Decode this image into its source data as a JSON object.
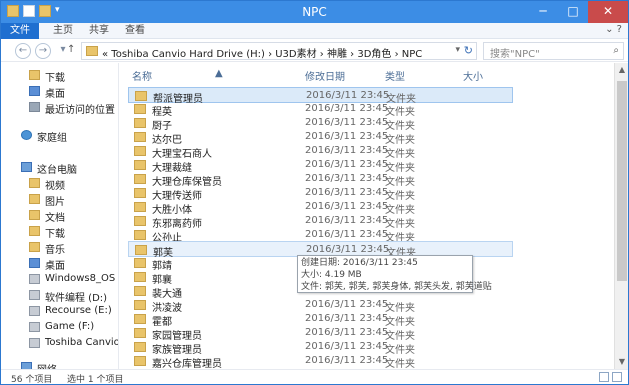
{
  "window": {
    "title": "NPC"
  },
  "ribbon": {
    "tabs": [
      "文件",
      "主页",
      "共享",
      "查看"
    ]
  },
  "address": {
    "path": "« Toshiba Canvio Hard Drive (H:) › U3D素材 › 神雕 › 3D角色 › NPC",
    "search_placeholder": "搜索\"NPC\""
  },
  "sidebar": {
    "items": [
      {
        "label": "下载",
        "icon": "download-folder-icon"
      },
      {
        "label": "桌面",
        "icon": "desktop-icon"
      },
      {
        "label": "最近访问的位置",
        "icon": "recent-places-icon"
      },
      {
        "label": "家庭组",
        "icon": "homegroup-icon"
      },
      {
        "label": "这台电脑",
        "icon": "this-pc-icon"
      },
      {
        "label": "视频",
        "icon": "videos-folder-icon"
      },
      {
        "label": "图片",
        "icon": "pictures-folder-icon"
      },
      {
        "label": "文档",
        "icon": "documents-folder-icon"
      },
      {
        "label": "下载",
        "icon": "download-folder-icon"
      },
      {
        "label": "音乐",
        "icon": "music-folder-icon"
      },
      {
        "label": "桌面",
        "icon": "desktop-icon"
      },
      {
        "label": "Windows8_OS (C",
        "icon": "drive-icon"
      },
      {
        "label": "软件编程 (D:)",
        "icon": "drive-icon"
      },
      {
        "label": "Recourse (E:)",
        "icon": "drive-icon"
      },
      {
        "label": "Game (F:)",
        "icon": "drive-icon"
      },
      {
        "label": "Toshiba Canvio I",
        "icon": "external-drive-icon"
      },
      {
        "label": "网络",
        "icon": "network-icon"
      }
    ]
  },
  "columns": [
    "名称",
    "修改日期",
    "类型",
    "大小"
  ],
  "files": [
    {
      "name": "帮派管理员",
      "date": "2016/3/11 23:45",
      "type": "文件夹"
    },
    {
      "name": "程英",
      "date": "2016/3/11 23:45",
      "type": "文件夹"
    },
    {
      "name": "厨子",
      "date": "2016/3/11 23:45",
      "type": "文件夹"
    },
    {
      "name": "达尔巴",
      "date": "2016/3/11 23:45",
      "type": "文件夹"
    },
    {
      "name": "大理宝石商人",
      "date": "2016/3/11 23:45",
      "type": "文件夹"
    },
    {
      "name": "大理裁缝",
      "date": "2016/3/11 23:45",
      "type": "文件夹"
    },
    {
      "name": "大理仓库保管员",
      "date": "2016/3/11 23:45",
      "type": "文件夹"
    },
    {
      "name": "大理传送师",
      "date": "2016/3/11 23:45",
      "type": "文件夹"
    },
    {
      "name": "大胜小体",
      "date": "2016/3/11 23:45",
      "type": "文件夹"
    },
    {
      "name": "东邪离药师",
      "date": "2016/3/11 23:45",
      "type": "文件夹"
    },
    {
      "name": "公孙止",
      "date": "2016/3/11 23:45",
      "type": "文件夹"
    },
    {
      "name": "郭芙",
      "date": "2016/3/11 23:45",
      "type": "文件夹"
    },
    {
      "name": "郭靖",
      "date": "",
      "type": ""
    },
    {
      "name": "郭襄",
      "date": "",
      "type": ""
    },
    {
      "name": "裴大通",
      "date": "",
      "type": ""
    },
    {
      "name": "洪凌波",
      "date": "2016/3/11 23:45",
      "type": "文件夹"
    },
    {
      "name": "霍都",
      "date": "2016/3/11 23:45",
      "type": "文件夹"
    },
    {
      "name": "家园管理员",
      "date": "2016/3/11 23:45",
      "type": "文件夹"
    },
    {
      "name": "家族管理员",
      "date": "2016/3/11 23:45",
      "type": "文件夹"
    },
    {
      "name": "嘉兴仓库管理员",
      "date": "2016/3/11 23:45",
      "type": "文件夹"
    }
  ],
  "tooltip": {
    "created": "创建日期: 2016/3/11 23:45",
    "size": "大小: 4.19 MB",
    "files": "文件: 郭芙, 郭芙, 郭芙身体, 郭芙头发, 郭芙道贴"
  },
  "status": {
    "count": "56 个项目",
    "selected": "选中 1 个项目"
  }
}
